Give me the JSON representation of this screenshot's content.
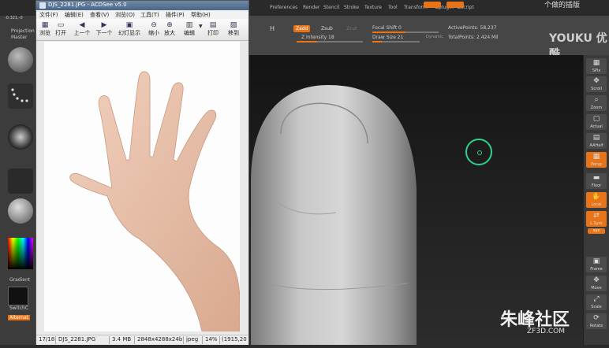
{
  "zbrush": {
    "menus": [
      "Preferences",
      "Render",
      "Stencil",
      "Stroke",
      "Texture",
      "Tool",
      "Transform",
      "Zplugin",
      "Zscript"
    ],
    "top_left_labels": [
      "Projection",
      "Master"
    ],
    "coord_readout": "-0.321,-0",
    "toolbar": {
      "h_label": "H",
      "zadd": "Zadd",
      "zsub": "Zsub",
      "zcut": "Zcut",
      "z_intensity": "Z Intensity 18",
      "focal_shift": "Focal Shift 0",
      "draw_size": "Draw Size 21",
      "dynamic": "Dynamic",
      "active_points": "ActivePoints: 58,237",
      "total_points": "TotalPoints: 2.424 Mil"
    },
    "left_tray": {
      "gradient_label": "Gradient",
      "switch_color_label": "SwitchC",
      "alternate_label": "Alternat"
    },
    "right_shelf": [
      {
        "label": "SPix",
        "glyph": "▦",
        "active": false
      },
      {
        "label": "Scroll",
        "glyph": "✥",
        "active": false
      },
      {
        "label": "Zoom",
        "glyph": "⌕",
        "active": false
      },
      {
        "label": "Actual",
        "glyph": "▢",
        "active": false
      },
      {
        "label": "AAHalf",
        "glyph": "▤",
        "active": false
      },
      {
        "label": "Persp",
        "glyph": "▦",
        "active": true
      },
      {
        "label": "Floor",
        "glyph": "▬",
        "active": false
      },
      {
        "label": "Local",
        "glyph": "✋",
        "active": true
      },
      {
        "label": "L.Sym",
        "glyph": "⇄",
        "active": true
      },
      {
        "label": "Frame",
        "glyph": "▣",
        "active": false
      },
      {
        "label": "Move",
        "glyph": "✥",
        "active": false
      },
      {
        "label": "Scale",
        "glyph": "⤢",
        "active": false
      },
      {
        "label": "Rotate",
        "glyph": "⟳",
        "active": false
      }
    ],
    "xyz_label": "xyz",
    "top_right_text": "个做的插版",
    "watermark_logo": "YOUKU 优酷",
    "watermark_site": "朱峰社区",
    "watermark_url": "ZF3D.COM"
  },
  "viewer": {
    "title": "DJS_2281.JPG - ACDSee v5.0",
    "menus": [
      "文件(F)",
      "编辑(E)",
      "查看(V)",
      "浏览(O)",
      "工具(T)",
      "插件(P)",
      "帮助(H)"
    ],
    "tools": [
      {
        "icon": "▦",
        "label": "浏览"
      },
      {
        "icon": "▭",
        "label": "打开"
      },
      {
        "icon": "◀",
        "label": "上一个"
      },
      {
        "icon": "▶",
        "label": "下一个"
      },
      {
        "icon": "▣",
        "label": "幻灯显示"
      },
      {
        "icon": "⊖",
        "label": "缩小"
      },
      {
        "icon": "⊕",
        "label": "放大"
      },
      {
        "icon": "▥",
        "label": "编辑"
      },
      {
        "icon": "▤",
        "label": "打印"
      },
      {
        "icon": "▧",
        "label": "移到"
      }
    ],
    "status": {
      "index": "17/18",
      "filename": "DJS_2281.JPG",
      "size": "3.4 MB",
      "dimensions": "2848x4288x24b",
      "format": "jpeg",
      "zoom": "14%",
      "coords": "(1915,20"
    }
  },
  "colors": {
    "accent_orange": "#e8741a",
    "brush_cursor": "#2fd08a"
  }
}
